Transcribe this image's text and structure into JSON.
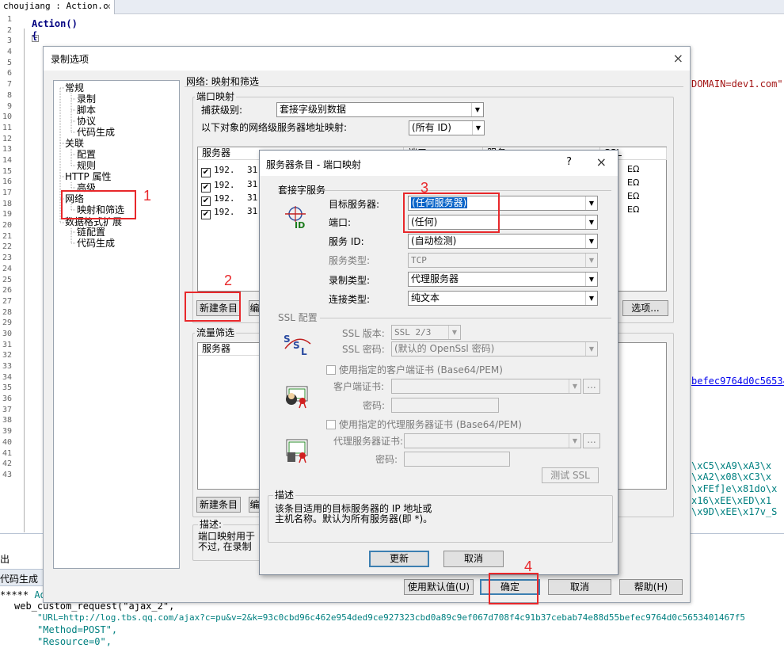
{
  "editor": {
    "tab_label": "choujiang : Action.c",
    "tab_close": "×",
    "line_numbers": [
      "1",
      "2",
      "3",
      "4",
      "5",
      "6",
      "7",
      "8",
      "9",
      "10",
      "11",
      "12",
      "13",
      "14",
      "15",
      "16",
      "17",
      "18",
      "19",
      "20",
      "21",
      "22",
      "23",
      "24",
      "25",
      "26",
      "27",
      "28",
      "29",
      "30",
      "31",
      "32",
      "33",
      "34",
      "35",
      "36",
      "37",
      "38",
      "39",
      "40",
      "41",
      "42",
      "43"
    ],
    "line1": "Action()",
    "line2": "{",
    "fragment_domain": "DOMAIN=dev1.com\")",
    "fragment_hash": "befec9764d0c56534",
    "fragment_38": "\\xC5\\xA9\\xA3\\x",
    "fragment_39": "\\xA2\\x08\\xC3\\x",
    "fragment_40": "\\xFEf]e\\x81do\\x",
    "fragment_41": "x16\\xEE\\xED\\x1",
    "fragment_42": "\\x9D\\xEE\\x17v_S",
    "bottom_tab_output": "出",
    "bottom_tab_codegen": "代码生成",
    "bottom_line1_prefix": "*****",
    "bottom_line1_text": "Ad",
    "bottom_line2": "web_custom_request(\"ajax_2\",",
    "bottom_line3": "\"URL=http://log.tbs.qq.com/ajax?c=pu&v=2&k=93c0cbd96c462e954ded9ce927323cbd0a89c9ef067d708f4c91b37cebab74e88d55befec9764d0c5653401467f5",
    "bottom_line4": "\"Method=POST\",",
    "bottom_line5": "\"Resource=0\","
  },
  "record_options": {
    "title": "录制选项",
    "close": "×",
    "tree": {
      "general": "常规",
      "recording": "录制",
      "script": "脚本",
      "protocol": "协议",
      "codegen": "代码生成",
      "correlation": "关联",
      "config": "配置",
      "rules": "规则",
      "http_props": "HTTP 属性",
      "advanced": "高级",
      "network": "网络",
      "mapping_filter": "映射和筛选",
      "data_format_ext": "数据格式扩展",
      "chain_config": "链配置",
      "codegen2": "代码生成"
    },
    "section_title": "网络: 映射和筛选",
    "port_mapping_group": "端口映射",
    "capture_level_label": "捕获级别:",
    "capture_level_value": "套接字级别数据",
    "server_map_label": "以下对象的网络级服务器地址映射:",
    "server_map_value": "(所有 ID)",
    "list_headers": [
      "服务器",
      "端口",
      "服务",
      "SSL"
    ],
    "rows": [
      {
        "server": "192.",
        "frag": "31.",
        "ssl": "EΩ"
      },
      {
        "server": "192.",
        "frag": "31.",
        "ssl": "EΩ"
      },
      {
        "server": "192.",
        "frag": "31.",
        "ssl": "EΩ"
      },
      {
        "server": "192.",
        "frag": "31.",
        "ssl": "EΩ"
      }
    ],
    "new_entry_button": "新建条目",
    "edit_fragment": "编",
    "options_button": "选项...",
    "traffic_filter_group": "流量筛选",
    "traffic_list_header": "服务器",
    "new_entry_button2": "新建条目",
    "edit_fragment2": "编",
    "desc_label": "描述:",
    "desc_line1": "端口映射用于",
    "desc_line2": "不过, 在录制",
    "use_default_button": "使用默认值(U)",
    "ok_button": "确定",
    "cancel_button": "取消",
    "help_button": "帮助(H)"
  },
  "server_entry": {
    "title": "服务器条目 - 端口映射",
    "help": "?",
    "close": "×",
    "socket_service_group": "套接字服务",
    "target_server_label": "目标服务器:",
    "target_server_value": "(任何服务器)",
    "port_label": "端口:",
    "port_value": "(任何)",
    "service_id_label": "服务 ID:",
    "service_id_value": "(自动检测)",
    "service_type_label": "服务类型:",
    "service_type_value": "TCP",
    "record_type_label": "录制类型:",
    "record_type_value": "代理服务器",
    "conn_type_label": "连接类型:",
    "conn_type_value": "纯文本",
    "ssl_group": "SSL 配置",
    "ssl_version_label": "SSL 版本:",
    "ssl_version_value": "SSL 2/3",
    "ssl_cipher_label": "SSL 密码:",
    "ssl_cipher_value": "(默认的 OpenSsl 密码)",
    "use_client_cert": "使用指定的客户端证书 (Base64/PEM)",
    "client_cert_label": "客户端证书:",
    "password_label": "密码:",
    "use_proxy_cert": "使用指定的代理服务器证书 (Base64/PEM)",
    "proxy_cert_label": "代理服务器证书:",
    "password_label2": "密码:",
    "browse": "...",
    "test_ssl_button": "测试 SSL",
    "desc_group": "描述",
    "desc_line1": "该条目适用的目标服务器的 IP 地址或",
    "desc_line2": "主机名称。默认为所有服务器(即 *)。",
    "update_button": "更新",
    "cancel_button": "取消",
    "icon_id_text": "ID",
    "icon_ssl_s1": "S",
    "icon_ssl_s2": "S",
    "icon_ssl_l": "L"
  },
  "annotations": {
    "n1": "1",
    "n2": "2",
    "n3": "3",
    "n4": "4",
    "color": "#e8282b"
  }
}
